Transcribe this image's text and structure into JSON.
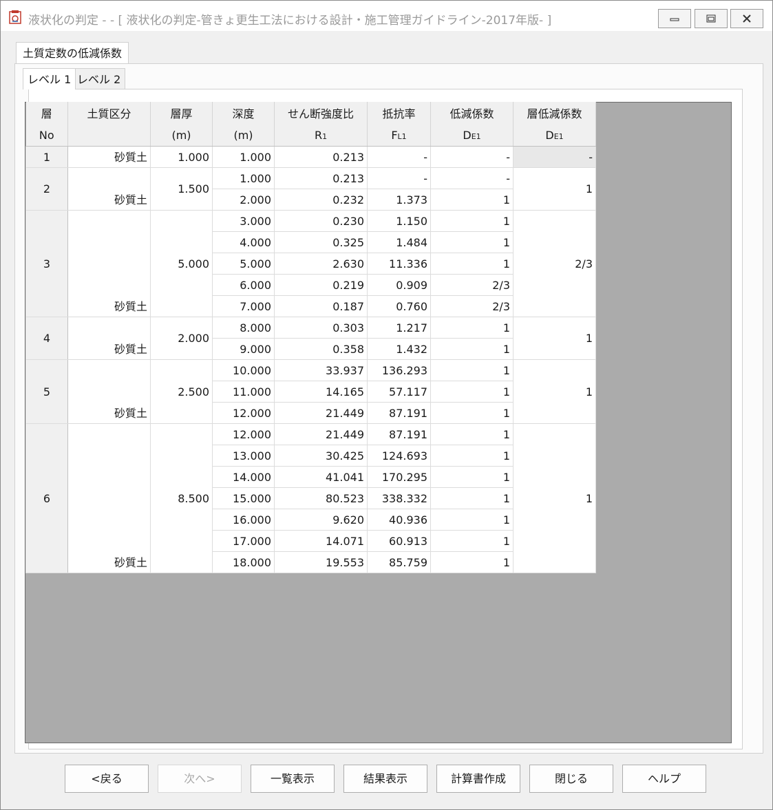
{
  "window": {
    "title": "液状化の判定 - - [ 液状化の判定-管きょ更生工法における設計・施工管理ガイドライン-2017年版- ]"
  },
  "tabs": {
    "main": "土質定数の低減係数",
    "sub": [
      "レベル 1",
      "レベル 2"
    ]
  },
  "table": {
    "headers": [
      {
        "top": "層",
        "bottom": "No"
      },
      {
        "top": "土質区分",
        "bottom": ""
      },
      {
        "top": "層厚",
        "bottom": "(m)"
      },
      {
        "top": "深度",
        "bottom": "(m)"
      },
      {
        "top": "せん断強度比",
        "bottom_main": "R",
        "bottom_sub": "1"
      },
      {
        "top": "抵抗率",
        "bottom_main": "F",
        "bottom_sub": "L1"
      },
      {
        "top": "低減係数",
        "bottom_main": "D",
        "bottom_sub": "E1"
      },
      {
        "top": "層低減係数",
        "bottom_main": "D",
        "bottom_sub": "E1"
      }
    ],
    "layers": [
      {
        "no": "1",
        "soil": "砂質土",
        "thickness": "1.000",
        "layer_factor": "-",
        "rows": [
          {
            "depth": "1.000",
            "ratio": "0.213",
            "fl": "-",
            "de": "-"
          }
        ]
      },
      {
        "no": "2",
        "soil": "砂質土",
        "thickness": "1.500",
        "layer_factor": "1",
        "rows": [
          {
            "depth": "1.000",
            "ratio": "0.213",
            "fl": "-",
            "de": "-"
          },
          {
            "depth": "2.000",
            "ratio": "0.232",
            "fl": "1.373",
            "de": "1"
          }
        ]
      },
      {
        "no": "3",
        "soil": "砂質土",
        "thickness": "5.000",
        "layer_factor": "2/3",
        "rows": [
          {
            "depth": "3.000",
            "ratio": "0.230",
            "fl": "1.150",
            "de": "1"
          },
          {
            "depth": "4.000",
            "ratio": "0.325",
            "fl": "1.484",
            "de": "1"
          },
          {
            "depth": "5.000",
            "ratio": "2.630",
            "fl": "11.336",
            "de": "1"
          },
          {
            "depth": "6.000",
            "ratio": "0.219",
            "fl": "0.909",
            "de": "2/3"
          },
          {
            "depth": "7.000",
            "ratio": "0.187",
            "fl": "0.760",
            "de": "2/3"
          }
        ]
      },
      {
        "no": "4",
        "soil": "砂質土",
        "thickness": "2.000",
        "layer_factor": "1",
        "rows": [
          {
            "depth": "8.000",
            "ratio": "0.303",
            "fl": "1.217",
            "de": "1"
          },
          {
            "depth": "9.000",
            "ratio": "0.358",
            "fl": "1.432",
            "de": "1"
          }
        ]
      },
      {
        "no": "5",
        "soil": "砂質土",
        "thickness": "2.500",
        "layer_factor": "1",
        "rows": [
          {
            "depth": "10.000",
            "ratio": "33.937",
            "fl": "136.293",
            "de": "1"
          },
          {
            "depth": "11.000",
            "ratio": "14.165",
            "fl": "57.117",
            "de": "1"
          },
          {
            "depth": "12.000",
            "ratio": "21.449",
            "fl": "87.191",
            "de": "1"
          }
        ]
      },
      {
        "no": "6",
        "soil": "砂質土",
        "thickness": "8.500",
        "layer_factor": "1",
        "rows": [
          {
            "depth": "12.000",
            "ratio": "21.449",
            "fl": "87.191",
            "de": "1"
          },
          {
            "depth": "13.000",
            "ratio": "30.425",
            "fl": "124.693",
            "de": "1"
          },
          {
            "depth": "14.000",
            "ratio": "41.041",
            "fl": "170.295",
            "de": "1"
          },
          {
            "depth": "15.000",
            "ratio": "80.523",
            "fl": "338.332",
            "de": "1"
          },
          {
            "depth": "16.000",
            "ratio": "9.620",
            "fl": "40.936",
            "de": "1"
          },
          {
            "depth": "17.000",
            "ratio": "14.071",
            "fl": "60.913",
            "de": "1"
          },
          {
            "depth": "18.000",
            "ratio": "19.553",
            "fl": "85.759",
            "de": "1"
          }
        ]
      }
    ]
  },
  "footer": {
    "buttons": [
      {
        "label": "<戻る",
        "name": "back-button",
        "enabled": true
      },
      {
        "label": "次へ>",
        "name": "next-button",
        "enabled": false
      },
      {
        "label": "一覧表示",
        "name": "list-view-button",
        "enabled": true
      },
      {
        "label": "結果表示",
        "name": "result-view-button",
        "enabled": true
      },
      {
        "label": "計算書作成",
        "name": "create-report-button",
        "enabled": true
      },
      {
        "label": "閉じる",
        "name": "close-button",
        "enabled": true
      },
      {
        "label": "ヘルプ",
        "name": "help-button",
        "enabled": true
      }
    ]
  },
  "colors": {
    "grid_background": "#ababab",
    "header_background": "#f0f0f0",
    "disabled_text": "#a8a8a8"
  }
}
